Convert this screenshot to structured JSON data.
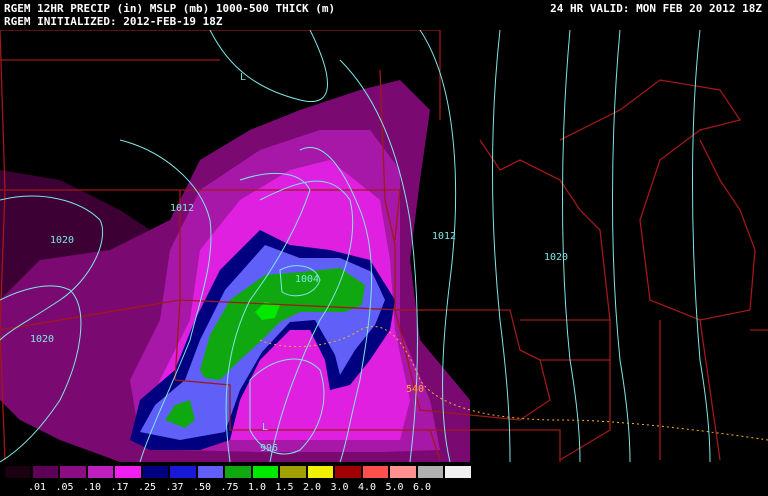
{
  "header": {
    "title_line1": "RGEM 12HR PRECIP (in) MSLP (mb) 1000-500 THICK (m)",
    "title_line2": "RGEM INITIALIZED: 2012-FEB-19 18Z",
    "valid": "24 HR VALID: MON FEB 20 2012 18Z"
  },
  "map": {
    "isobar_labels": [
      "1012",
      "1020",
      "1020",
      "1004",
      "1012",
      "1020",
      "996"
    ],
    "low_markers": [
      "L",
      "L"
    ],
    "thickness_label": "540",
    "isobar_color": "#7fe6e6",
    "border_color": "#a01818",
    "thickness_color": "#ffb020"
  },
  "legend": {
    "labels": [
      ".01",
      ".05",
      ".10",
      ".17",
      ".25",
      ".37",
      ".50",
      ".75",
      "1.0",
      "1.5",
      "2.0",
      "3.0",
      "4.0",
      "5.0",
      "6.0"
    ],
    "colors": [
      "#1a0010",
      "#5e0058",
      "#8c0c84",
      "#c020c0",
      "#f020f0",
      "#000080",
      "#1818d8",
      "#6060f8",
      "#10a810",
      "#00e800",
      "#a0a000",
      "#f0f000",
      "#a00000",
      "#ff5050",
      "#ff9090",
      "#b0b0b0",
      "#f0f0f0"
    ]
  }
}
